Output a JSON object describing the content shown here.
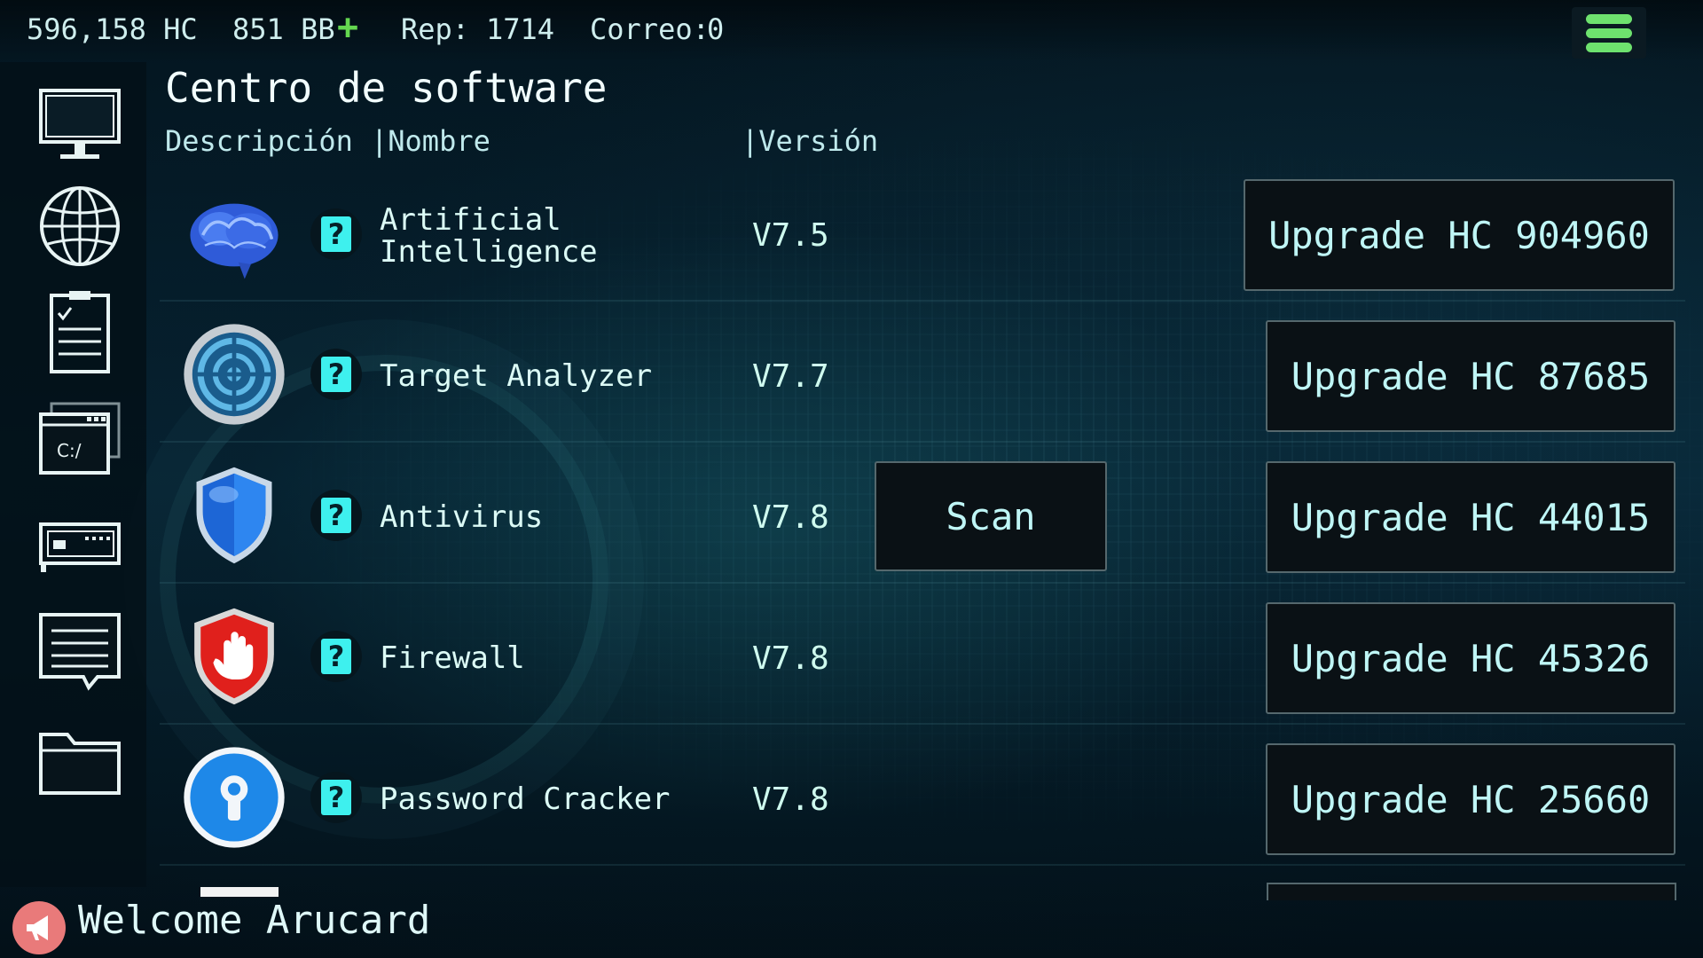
{
  "status": {
    "hc": "596,158 HC",
    "bb": "851 BB",
    "bb_add": "+",
    "rep_label": "Rep:",
    "rep_value": "1714",
    "mail_label": "Correo:",
    "mail_value": "0"
  },
  "sidebar": {
    "items": [
      {
        "icon": "monitor-icon"
      },
      {
        "icon": "globe-icon"
      },
      {
        "icon": "clipboard-icon"
      },
      {
        "icon": "terminal-icon",
        "text": "C:/"
      },
      {
        "icon": "hardware-icon"
      },
      {
        "icon": "chat-icon"
      },
      {
        "icon": "folder-icon"
      }
    ]
  },
  "page": {
    "title": "Centro de software",
    "col_desc": "Descripción",
    "col_name": "|Nombre",
    "col_version": "|Versión"
  },
  "software": [
    {
      "icon": "brain-icon",
      "name_line1": "Artificial",
      "name_line2": "Intelligence",
      "version": "V7.5",
      "upgrade": "Upgrade HC 904960"
    },
    {
      "icon": "target-icon",
      "name_line1": "Target Analyzer",
      "name_line2": "",
      "version": "V7.7",
      "upgrade": "Upgrade HC 87685"
    },
    {
      "icon": "shield-icon",
      "name_line1": "Antivirus",
      "name_line2": "",
      "version": "V7.8",
      "upgrade": "Upgrade HC 44015",
      "action": "Scan"
    },
    {
      "icon": "firewall-hand-icon",
      "name_line1": "Firewall",
      "name_line2": "",
      "version": "V7.8",
      "upgrade": "Upgrade HC 45326"
    },
    {
      "icon": "keyhole-icon",
      "name_line1": "Password Cracker",
      "name_line2": "",
      "version": "V7.8",
      "upgrade": "Upgrade HC 25660"
    }
  ],
  "help_badge": "?",
  "footer": {
    "welcome": "Welcome Arucard"
  },
  "colors": {
    "accent_green": "#6ee26e",
    "help_cyan": "#3ef0ee",
    "button_border": "#55686d"
  }
}
